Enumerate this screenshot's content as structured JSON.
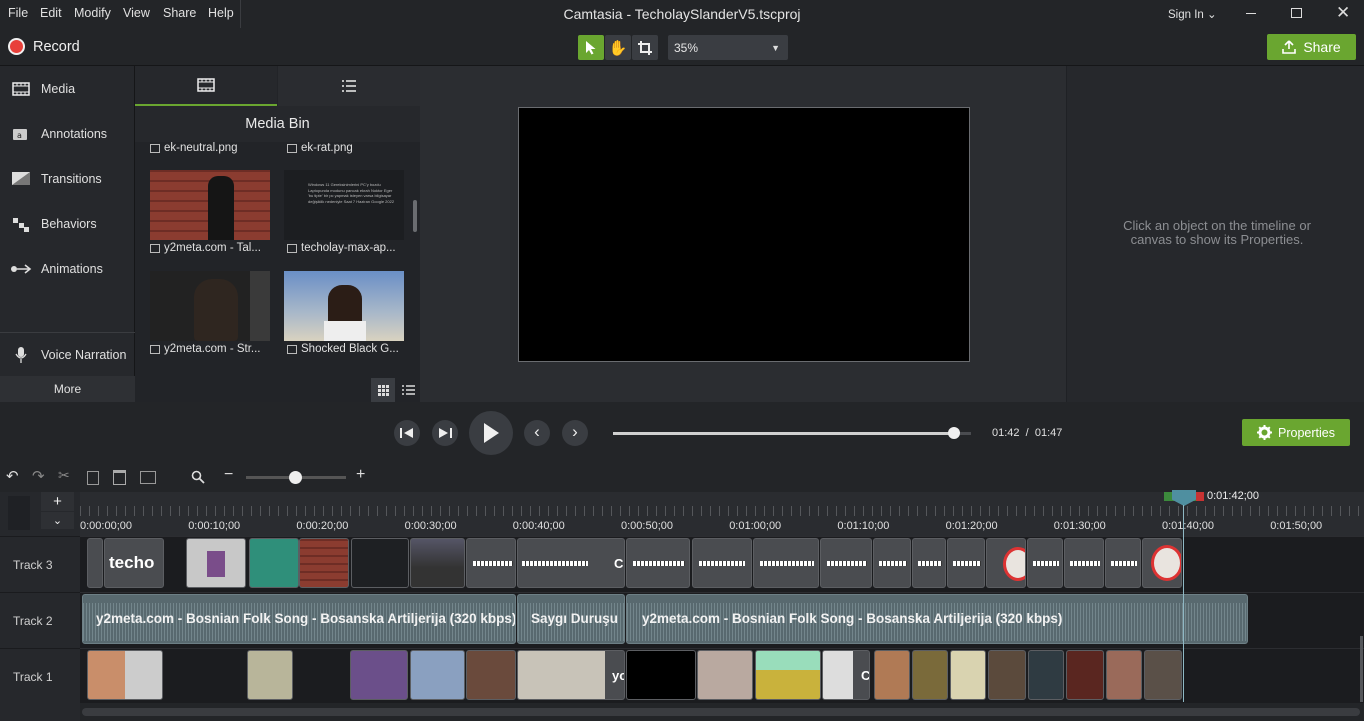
{
  "window": {
    "title": "Camtasia - TecholaySlanderV5.tscproj",
    "sign_in": "Sign In"
  },
  "menu": [
    "File",
    "Edit",
    "Modify",
    "View",
    "Share",
    "Help"
  ],
  "toolbar": {
    "record_label": "Record",
    "zoom_value": "35%",
    "share_label": "Share"
  },
  "nav": {
    "items": [
      {
        "label": "Media",
        "icon": "film-icon"
      },
      {
        "label": "Annotations",
        "icon": "annotation-icon"
      },
      {
        "label": "Transitions",
        "icon": "transition-icon"
      },
      {
        "label": "Behaviors",
        "icon": "behaviors-icon"
      },
      {
        "label": "Animations",
        "icon": "animation-arrow-icon"
      },
      {
        "label": "Voice Narration",
        "icon": "microphone-icon"
      }
    ],
    "more_label": "More"
  },
  "media_bin": {
    "header": "Media Bin",
    "items": [
      {
        "name": "ek-neutral.png",
        "kind": "image"
      },
      {
        "name": "ek-rat.png",
        "kind": "image"
      },
      {
        "name": "y2meta.com - Tal...",
        "kind": "video"
      },
      {
        "name": "techolay-max-ap...",
        "kind": "image"
      },
      {
        "name": "y2meta.com - Str...",
        "kind": "video"
      },
      {
        "name": "Shocked Black G...",
        "kind": "video"
      }
    ],
    "tweet_text": "Windows 11 Gereksinimlerini PC'y bozdu Laptopunda modunu pancak ekrah Noktor Eger 'bu tipte' bir pc yapmak isteyen varsa bilgisayar değişiklik nedeniyle Saat 7 Haziran Google 2022"
  },
  "properties": {
    "hint": "Click an object on the timeline or canvas to show its Properties.",
    "button_label": "Properties"
  },
  "playback": {
    "current_time": "01:42",
    "separator": "/",
    "total_time": "01:47",
    "progress": 0.953
  },
  "timeline": {
    "playhead_time": "0:01:42;00",
    "ruler_labels": [
      "0:00:00;00",
      "0:00:10;00",
      "0:00:20;00",
      "0:00:30;00",
      "0:00:40;00",
      "0:00:50;00",
      "0:01:00;00",
      "0:01:10;00",
      "0:01:20;00",
      "0:01:30;00",
      "0:01:40;00",
      "0:01:50;00"
    ],
    "tracks": [
      "Track 3",
      "Track 2",
      "Track 1"
    ],
    "track3_text_clip": "techo",
    "track3_letter": "C",
    "audio_clips": [
      "y2meta.com - Bosnian Folk Song - Bosanska Artiljerija (320 kbps)",
      "Saygı Duruşu",
      "y2meta.com - Bosnian Folk Song - Bosanska Artiljerija (320 kbps)"
    ],
    "track1_letters": [
      "yo",
      "C"
    ]
  },
  "colors": {
    "accent_green": "#6aa630",
    "record_red": "#e8403a",
    "playhead": "#4f8fa0"
  }
}
